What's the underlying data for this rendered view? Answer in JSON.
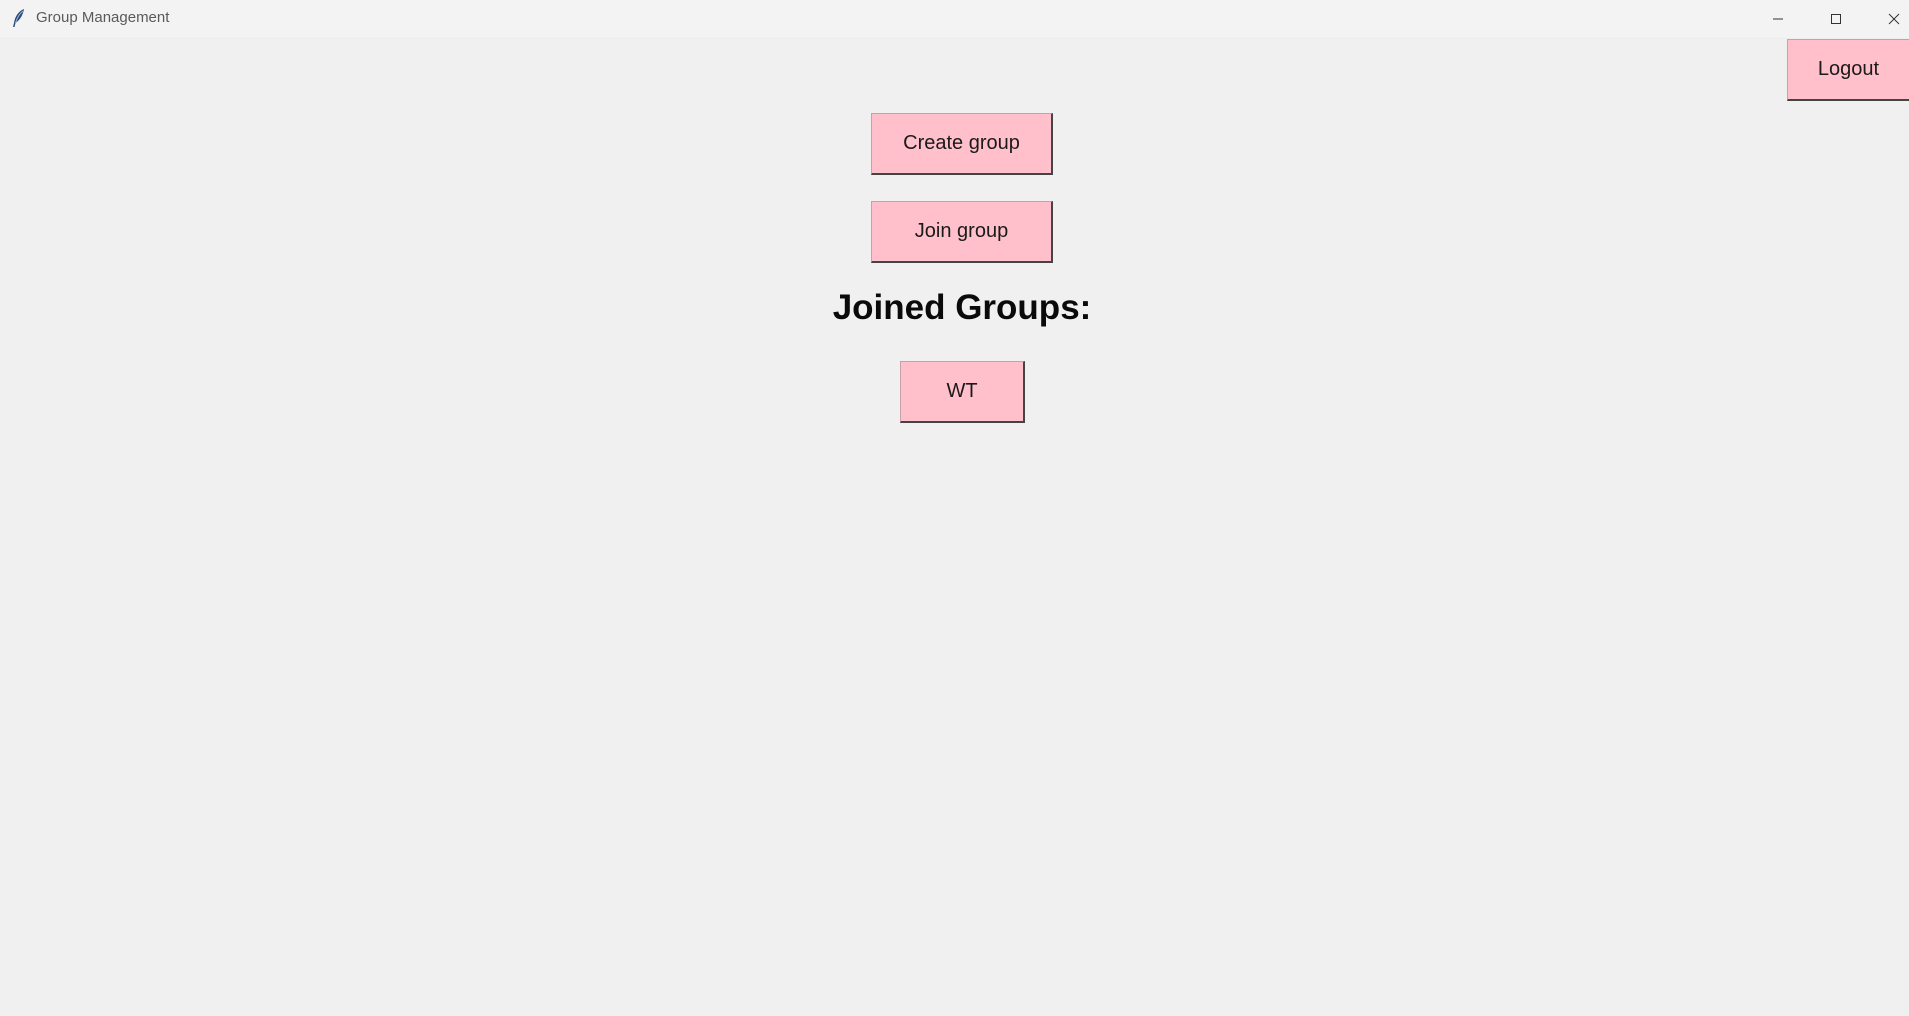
{
  "window": {
    "title": "Group Management",
    "app_icon": "feather-icon",
    "controls": {
      "minimize_icon": "minimize-icon",
      "maximize_icon": "maximize-icon",
      "close_icon": "close-icon"
    }
  },
  "colors": {
    "button_bg": "#ffc0cb",
    "window_bg": "#f0f0f0"
  },
  "toolbar": {
    "logout_label": "Logout"
  },
  "main": {
    "create_group_label": "Create group",
    "join_group_label": "Join group",
    "joined_groups_heading": "Joined Groups:",
    "joined_groups": [
      {
        "label": "WT"
      }
    ]
  }
}
